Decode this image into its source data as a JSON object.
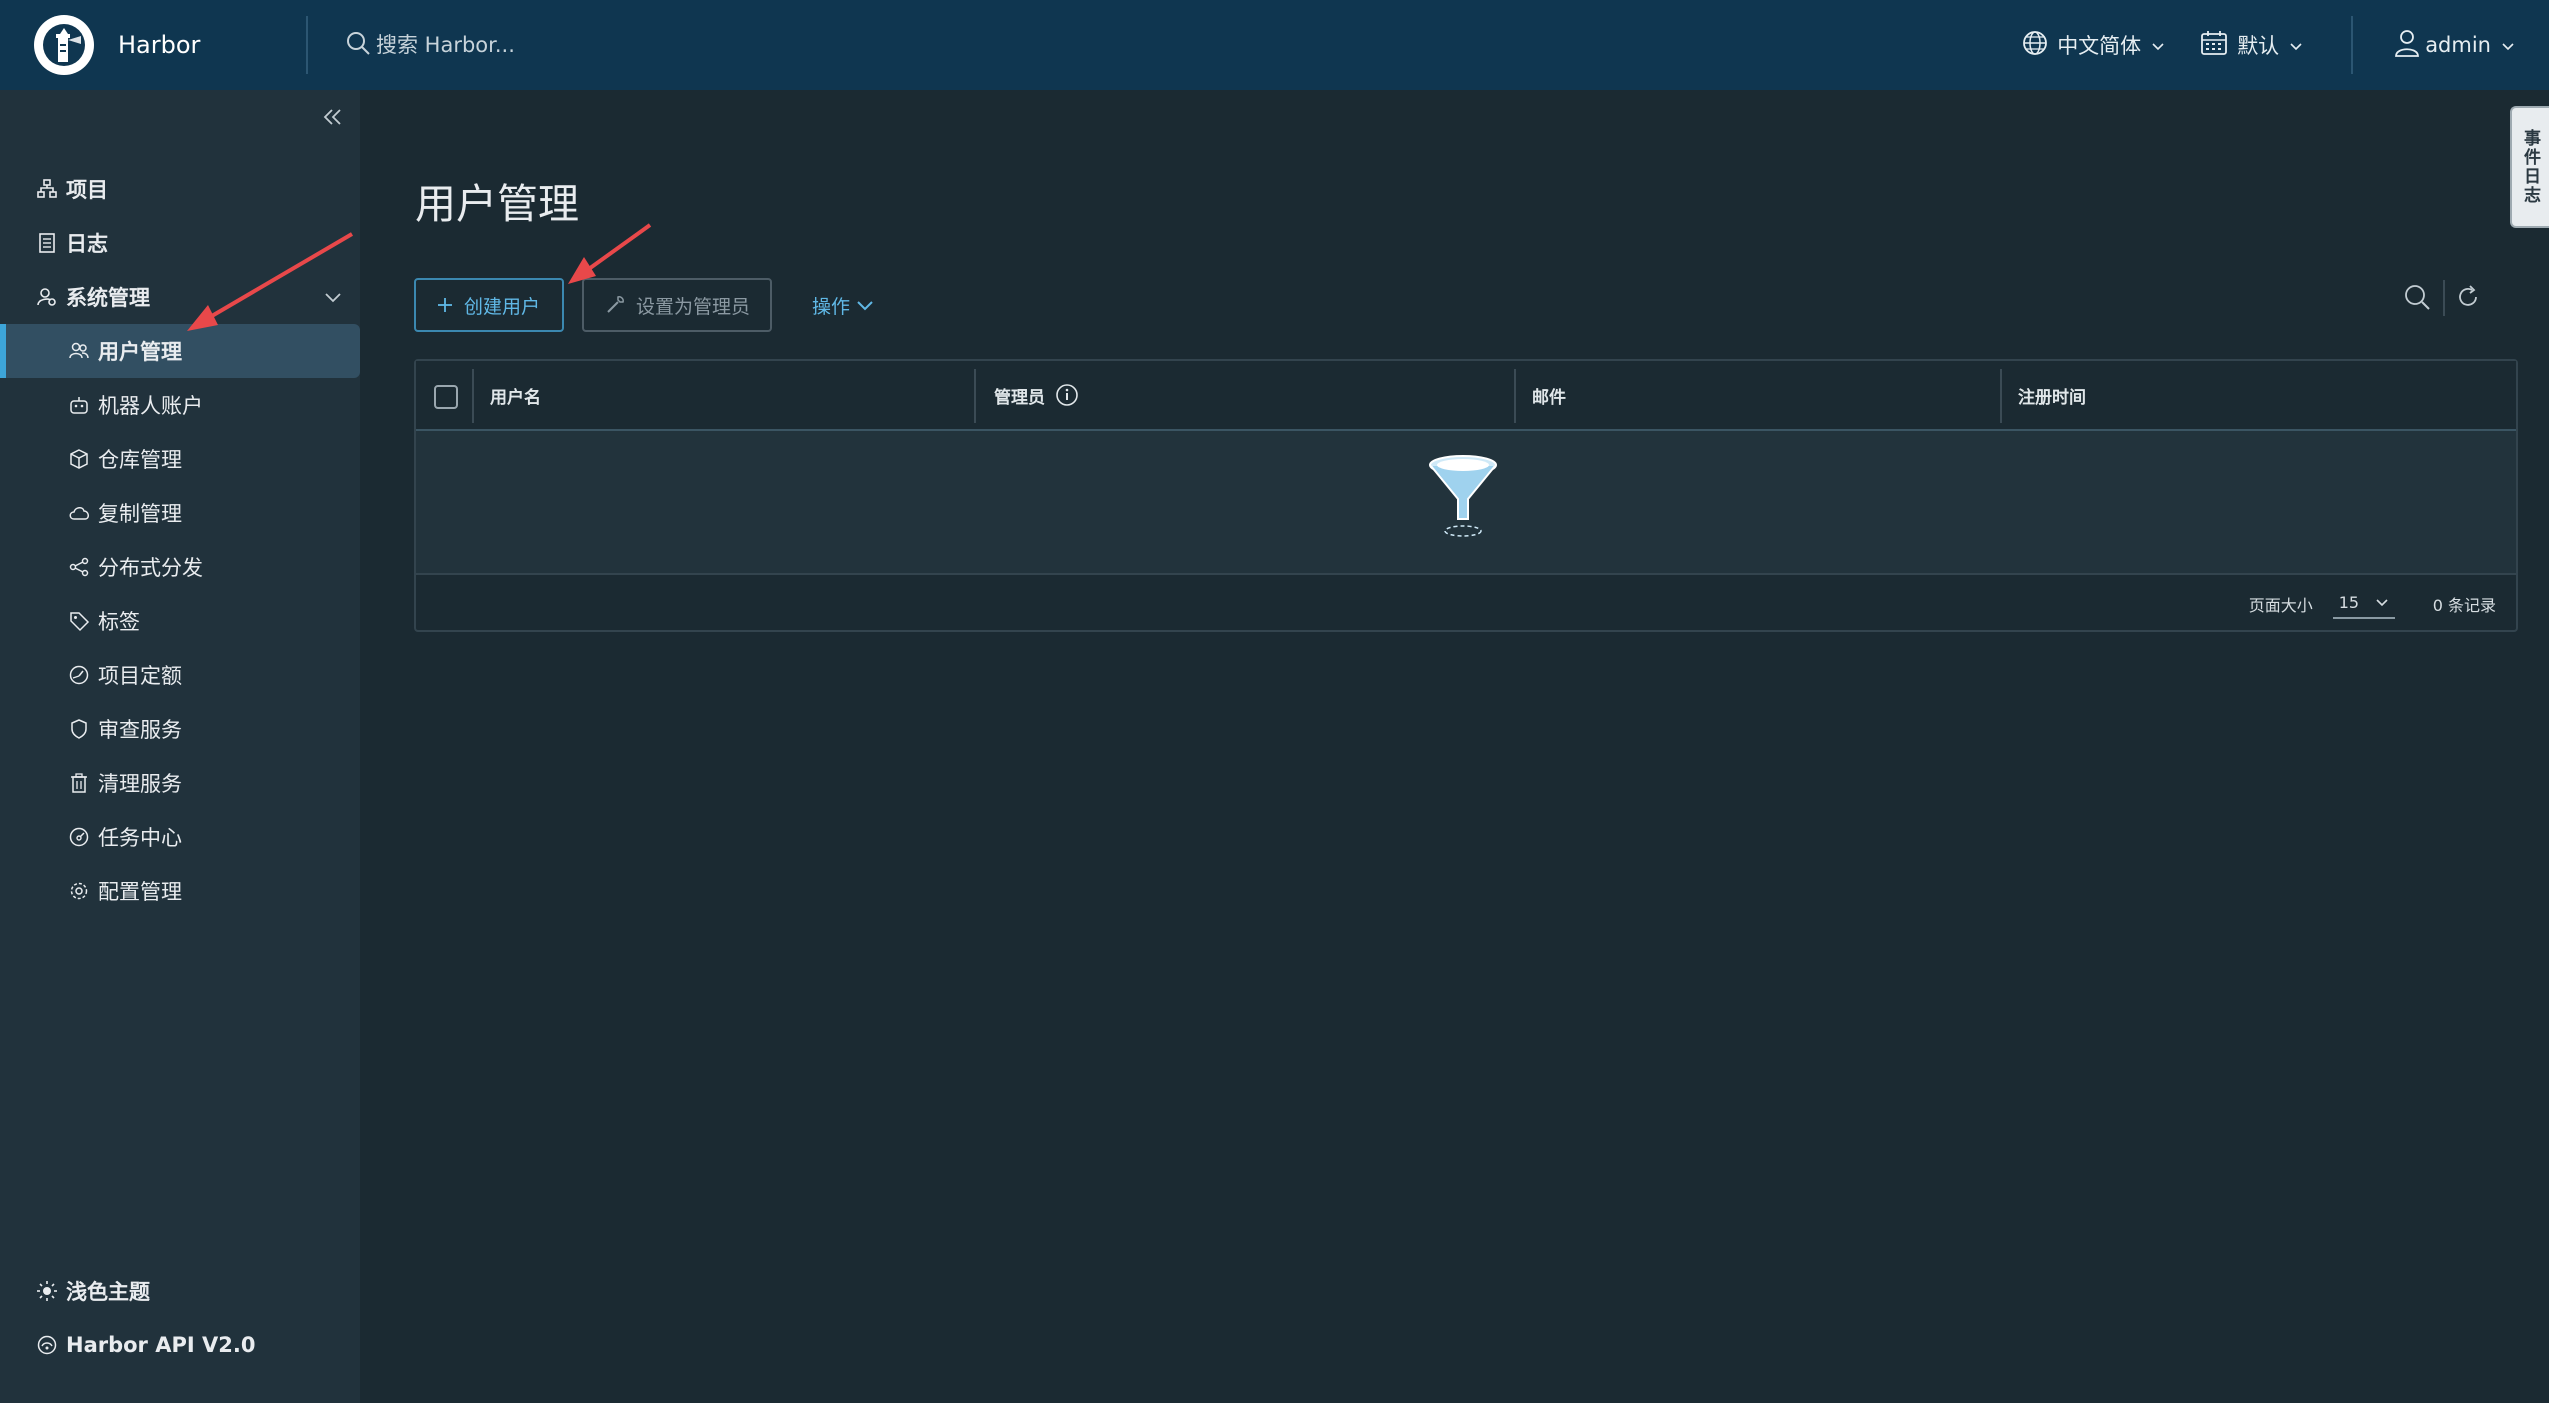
{
  "header": {
    "app_name": "Harbor",
    "search_placeholder": "搜索 Harbor...",
    "language": "中文简体",
    "datetime_format": "默认",
    "user": "admin"
  },
  "sidebar": {
    "items": [
      {
        "label": "项目",
        "icon": "project-icon"
      },
      {
        "label": "日志",
        "icon": "log-icon"
      },
      {
        "label": "系统管理",
        "icon": "admin-icon"
      }
    ],
    "sub_items": [
      {
        "label": "用户管理",
        "icon": "users-icon",
        "active": true
      },
      {
        "label": "机器人账户",
        "icon": "robot-icon"
      },
      {
        "label": "仓库管理",
        "icon": "box-icon"
      },
      {
        "label": "复制管理",
        "icon": "cloud-icon"
      },
      {
        "label": "分布式分发",
        "icon": "share-icon"
      },
      {
        "label": "标签",
        "icon": "tag-icon"
      },
      {
        "label": "项目定额",
        "icon": "gauge-icon"
      },
      {
        "label": "审查服务",
        "icon": "shield-icon"
      },
      {
        "label": "清理服务",
        "icon": "trash-icon"
      },
      {
        "label": "任务中心",
        "icon": "dashboard-icon"
      },
      {
        "label": "配置管理",
        "icon": "gear-icon"
      }
    ],
    "bottom": [
      {
        "label": "浅色主题",
        "icon": "sun-icon"
      },
      {
        "label": "Harbor API V2.0",
        "icon": "api-icon"
      }
    ]
  },
  "main": {
    "title": "用户管理",
    "buttons": {
      "create_user": "创建用户",
      "set_admin": "设置为管理员",
      "actions": "操作"
    },
    "table": {
      "columns": [
        "用户名",
        "管理员",
        "邮件",
        "注册时间"
      ],
      "rows": [],
      "page_size_label": "页面大小",
      "page_size": "15",
      "records": "0 条记录"
    }
  },
  "side_tab": "事件日志",
  "colors": {
    "header_bg": "#0f3650",
    "sidebar_bg": "#21323c",
    "content_bg": "#1b2a32",
    "accent": "#60b8e6",
    "annotation_arrow": "#e8484a"
  }
}
